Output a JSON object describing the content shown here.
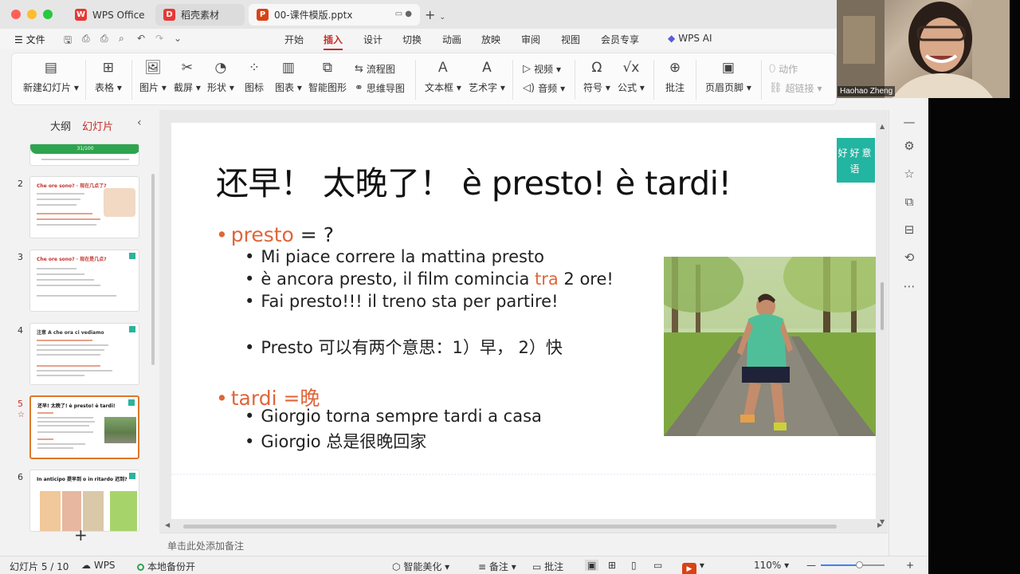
{
  "tabs": [
    {
      "label": "WPS Office",
      "icon": "W"
    },
    {
      "label": "稻壳素材",
      "icon": "D"
    },
    {
      "label": "00-课件模版.pptx",
      "icon": "P"
    }
  ],
  "menu": {
    "file": "文件",
    "items": [
      "开始",
      "插入",
      "设计",
      "切换",
      "动画",
      "放映",
      "审阅",
      "视图",
      "会员专享"
    ],
    "active": "插入",
    "ai": "WPS AI"
  },
  "ribbon": {
    "new_slide": "新建幻灯片",
    "table": "表格",
    "image": "图片",
    "screenshot": "截屏",
    "shape": "形状",
    "icon": "图标",
    "chart": "图表",
    "smart_graphic": "智能图形",
    "flowchart": "流程图",
    "mindmap": "思维导图",
    "textbox": "文本框",
    "wordart": "艺术字",
    "video": "视频",
    "audio": "音频",
    "symbol": "符号",
    "formula": "公式",
    "comment": "批注",
    "header_footer": "页眉页脚",
    "action": "动作",
    "hyperlink": "超链接"
  },
  "left_panel": {
    "tab_outline": "大纲",
    "tab_slides": "幻灯片",
    "thumbs": [
      {
        "num": "2",
        "title": "Che ore sono? · 现在几点了?"
      },
      {
        "num": "3",
        "title": "Che ore sono? · 现在是几点?"
      },
      {
        "num": "4",
        "title": "注意 A che ora ci vediamo"
      },
      {
        "num": "5",
        "title": "还早! 太晚了! è presto! è tardi!"
      },
      {
        "num": "6",
        "title": "In anticipo 提早到 o in ritardo 迟到?"
      }
    ],
    "top_partial": "31/100"
  },
  "slide": {
    "title": "还早！  太晚了！ è presto! è tardi!",
    "badge": "好好意语",
    "presto_word": "presto",
    "presto_rest": " = ?",
    "presto_examples": [
      "Mi piace correre la mattina presto",
      "è ancora presto, il film comincia ",
      "Fai presto!!! il treno sta per partire!"
    ],
    "tra_word": "tra",
    "tra_rest": " 2 ore!",
    "presto_meaning": "Presto 可以有两个意思：1）早， 2）快",
    "tardi_word": "tardi =晚",
    "tardi_examples": [
      "Giorgio torna sempre tardi a casa",
      "Giorgio 总是很晚回家"
    ]
  },
  "notes_placeholder": "单击此处添加备注",
  "status": {
    "slide_count": "幻灯片 5 / 10",
    "wps": "WPS",
    "backup": "本地备份开",
    "beautify": "智能美化",
    "notes": "备注",
    "comments": "批注",
    "zoom": "110%"
  },
  "webcam": {
    "name": "Haohao Zheng"
  }
}
